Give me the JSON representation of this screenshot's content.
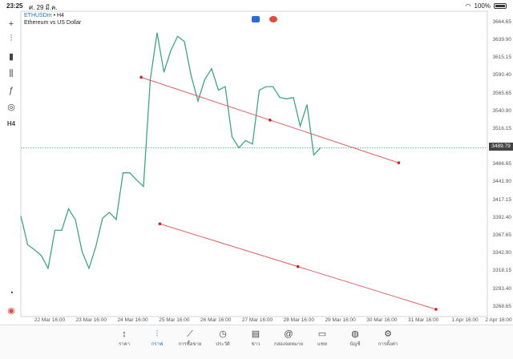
{
  "status": {
    "time": "23:25",
    "date": "ศ. 29 มี.ค.",
    "battery": "100%"
  },
  "symbol": {
    "name": "ETHUSDm",
    "timeframe": "• H4",
    "desc": "Ethereum vs US Dollar"
  },
  "toolbar": [
    {
      "icon": "crosshair-icon",
      "glyph": "+"
    },
    {
      "icon": "candles-icon",
      "glyph": "⫶"
    },
    {
      "icon": "bars-icon",
      "glyph": "▮"
    },
    {
      "icon": "indicators-icon",
      "glyph": "⫼"
    },
    {
      "icon": "function-icon",
      "glyph": "ƒ"
    },
    {
      "icon": "objects-icon",
      "glyph": "◎"
    },
    {
      "icon": "timeframe-label",
      "glyph": "H4"
    }
  ],
  "bottom_tools": [
    {
      "icon": "chart-settings-icon",
      "glyph": "◔"
    },
    {
      "icon": "app-logo-icon",
      "glyph": "◉"
    }
  ],
  "chart_data": {
    "type": "line",
    "y_ticks": [
      "3664.65",
      "3639.90",
      "3615.15",
      "3590.40",
      "3565.65",
      "3540.90",
      "3516.15",
      "3466.65",
      "3441.90",
      "3417.15",
      "3392.40",
      "3367.65",
      "3342.90",
      "3318.15",
      "3293.40",
      "3268.65"
    ],
    "current_price": "3489.79",
    "x_ticks": [
      "22 Mar 16:00",
      "23 Mar 16:00",
      "24 Mar 16:00",
      "25 Mar 16:00",
      "26 Mar 16:00",
      "27 Mar 16:00",
      "28 Mar 16:00",
      "29 Mar 16:00",
      "30 Mar 16:00",
      "31 Mar 16:00",
      "1 Apr 16:00",
      "2 Apr 16:00"
    ],
    "ylim": [
      3255,
      3680
    ],
    "series": [
      {
        "color": "#3aa982",
        "values": [
          3395,
          3355,
          3348,
          3340,
          3322,
          3375,
          3375,
          3405,
          3390,
          3345,
          3322,
          3352,
          3392,
          3400,
          3390,
          3455,
          3455,
          3445,
          3436,
          3585,
          3650,
          3595,
          3625,
          3645,
          3638,
          3590,
          3555,
          3585,
          3600,
          3570,
          3575,
          3505,
          3490,
          3500,
          3495,
          3570,
          3575,
          3575,
          3560,
          3558,
          3560,
          3520,
          3550,
          3480,
          3490
        ]
      }
    ],
    "trendlines": [
      {
        "from": [
          0.258,
          3588
        ],
        "to": [
          0.81,
          3469
        ]
      },
      {
        "from": [
          0.298,
          3384
        ],
        "to": [
          0.89,
          3265
        ]
      }
    ],
    "grid": false
  },
  "tabs": [
    {
      "label": "ราคา",
      "icon": "quotes-icon",
      "glyph": "↕"
    },
    {
      "label": "กราฟ",
      "icon": "chart-icon",
      "glyph": "⫶",
      "active": true
    },
    {
      "label": "การซื้อขาย",
      "icon": "trade-icon",
      "glyph": "⟋"
    },
    {
      "label": "ประวัติ",
      "icon": "history-icon",
      "glyph": "◷"
    },
    {
      "label": "ข่าว",
      "icon": "news-icon",
      "glyph": "▤"
    },
    {
      "label": "กล่องจดหมาย",
      "icon": "mailbox-icon",
      "glyph": "@"
    },
    {
      "label": "แชท",
      "icon": "chat-icon",
      "glyph": "▭"
    },
    {
      "label": "บัญชี",
      "icon": "account-icon",
      "glyph": "◍"
    },
    {
      "label": "การตั้งค่า",
      "icon": "settings-icon",
      "glyph": "⚙"
    }
  ]
}
